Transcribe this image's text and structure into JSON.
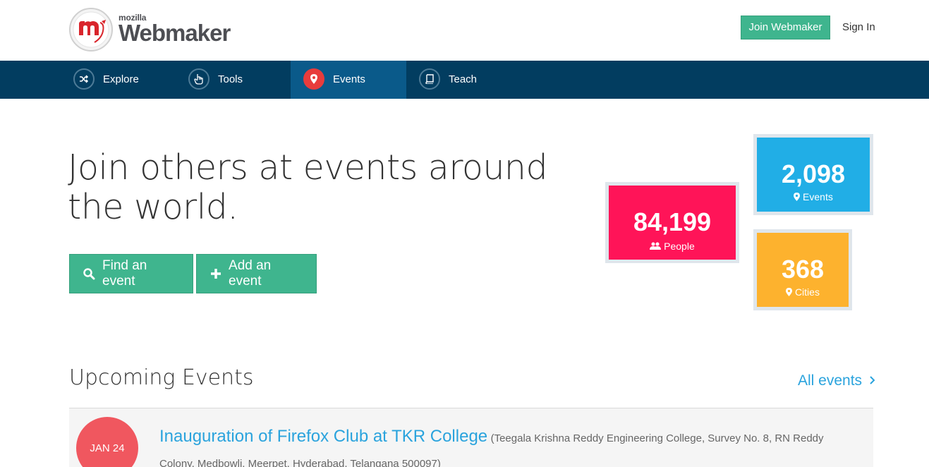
{
  "header": {
    "logo_small": "mozilla",
    "logo_word": "Webmaker",
    "join_label": "Join Webmaker",
    "signin_label": "Sign In"
  },
  "nav": {
    "items": [
      {
        "label": "Explore",
        "icon": "shuffle-icon"
      },
      {
        "label": "Tools",
        "icon": "pointer-hand-icon"
      },
      {
        "label": "Events",
        "icon": "map-pin-icon",
        "active": true
      },
      {
        "label": "Teach",
        "icon": "book-icon"
      }
    ]
  },
  "hero": {
    "title_line1": "Join others at events around",
    "title_line2": "the world.",
    "find_label": "Find an event",
    "add_label": "Add an event"
  },
  "stats": {
    "people": {
      "value": "84,199",
      "label": "People",
      "color": "#ff1458"
    },
    "events": {
      "value": "2,098",
      "label": "Events",
      "color": "#21aee6"
    },
    "cities": {
      "value": "368",
      "label": "Cities",
      "color": "#fdb22e"
    }
  },
  "upcoming": {
    "title": "Upcoming Events",
    "all_label": "All events",
    "events": [
      {
        "date": "JAN 24",
        "title": "Inauguration of Firefox Club at TKR College",
        "address": "(Teegala Krishna Reddy Engineering College, Survey No. 8, RN Reddy Colony, Medbowli, Meerpet, Hyderabad, Telangana 500097)"
      }
    ]
  },
  "colors": {
    "accent_green": "#3fb58e",
    "nav_bg": "#023d60",
    "link_blue": "#2aa3dd"
  }
}
